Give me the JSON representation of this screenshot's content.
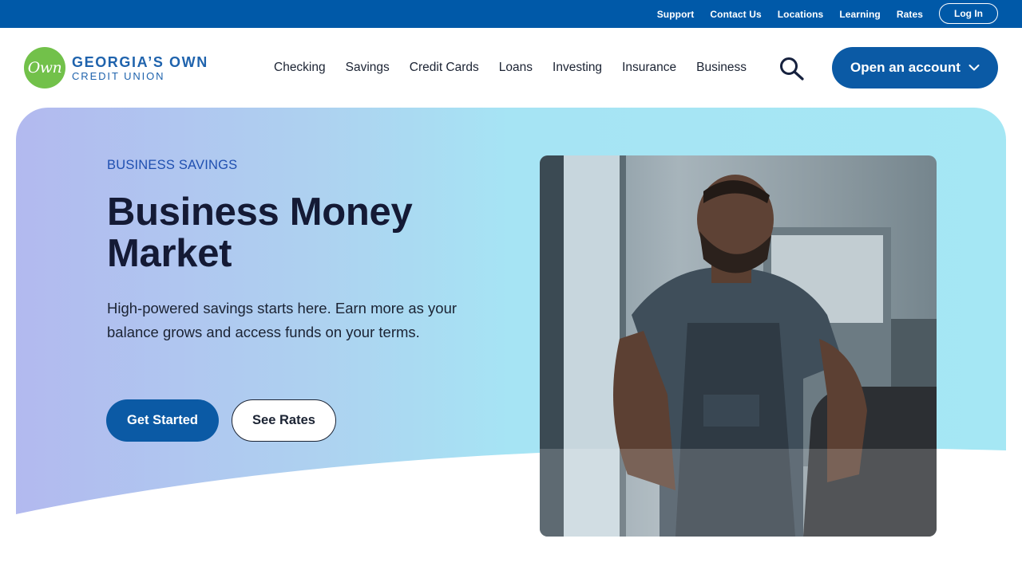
{
  "utility": {
    "links": [
      "Support",
      "Contact Us",
      "Locations",
      "Learning",
      "Rates"
    ],
    "login_label": "Log In"
  },
  "brand": {
    "logo_mark": "Own",
    "name_line1": "GEORGIA’S OWN",
    "name_line2": "CREDIT UNION",
    "primary_color": "#0b5aa5",
    "logo_green": "#72c14a"
  },
  "nav": {
    "items": [
      "Checking",
      "Savings",
      "Credit Cards",
      "Loans",
      "Investing",
      "Insurance",
      "Business"
    ],
    "search_icon": "search-icon",
    "cta_label": "Open an account"
  },
  "hero": {
    "eyebrow": "BUSINESS SAVINGS",
    "title": "Business Money Market",
    "subtitle": "High-powered savings starts here. Earn more as your balance grows and access funds on your terms.",
    "primary_button": "Get Started",
    "secondary_button": "See Rates"
  }
}
